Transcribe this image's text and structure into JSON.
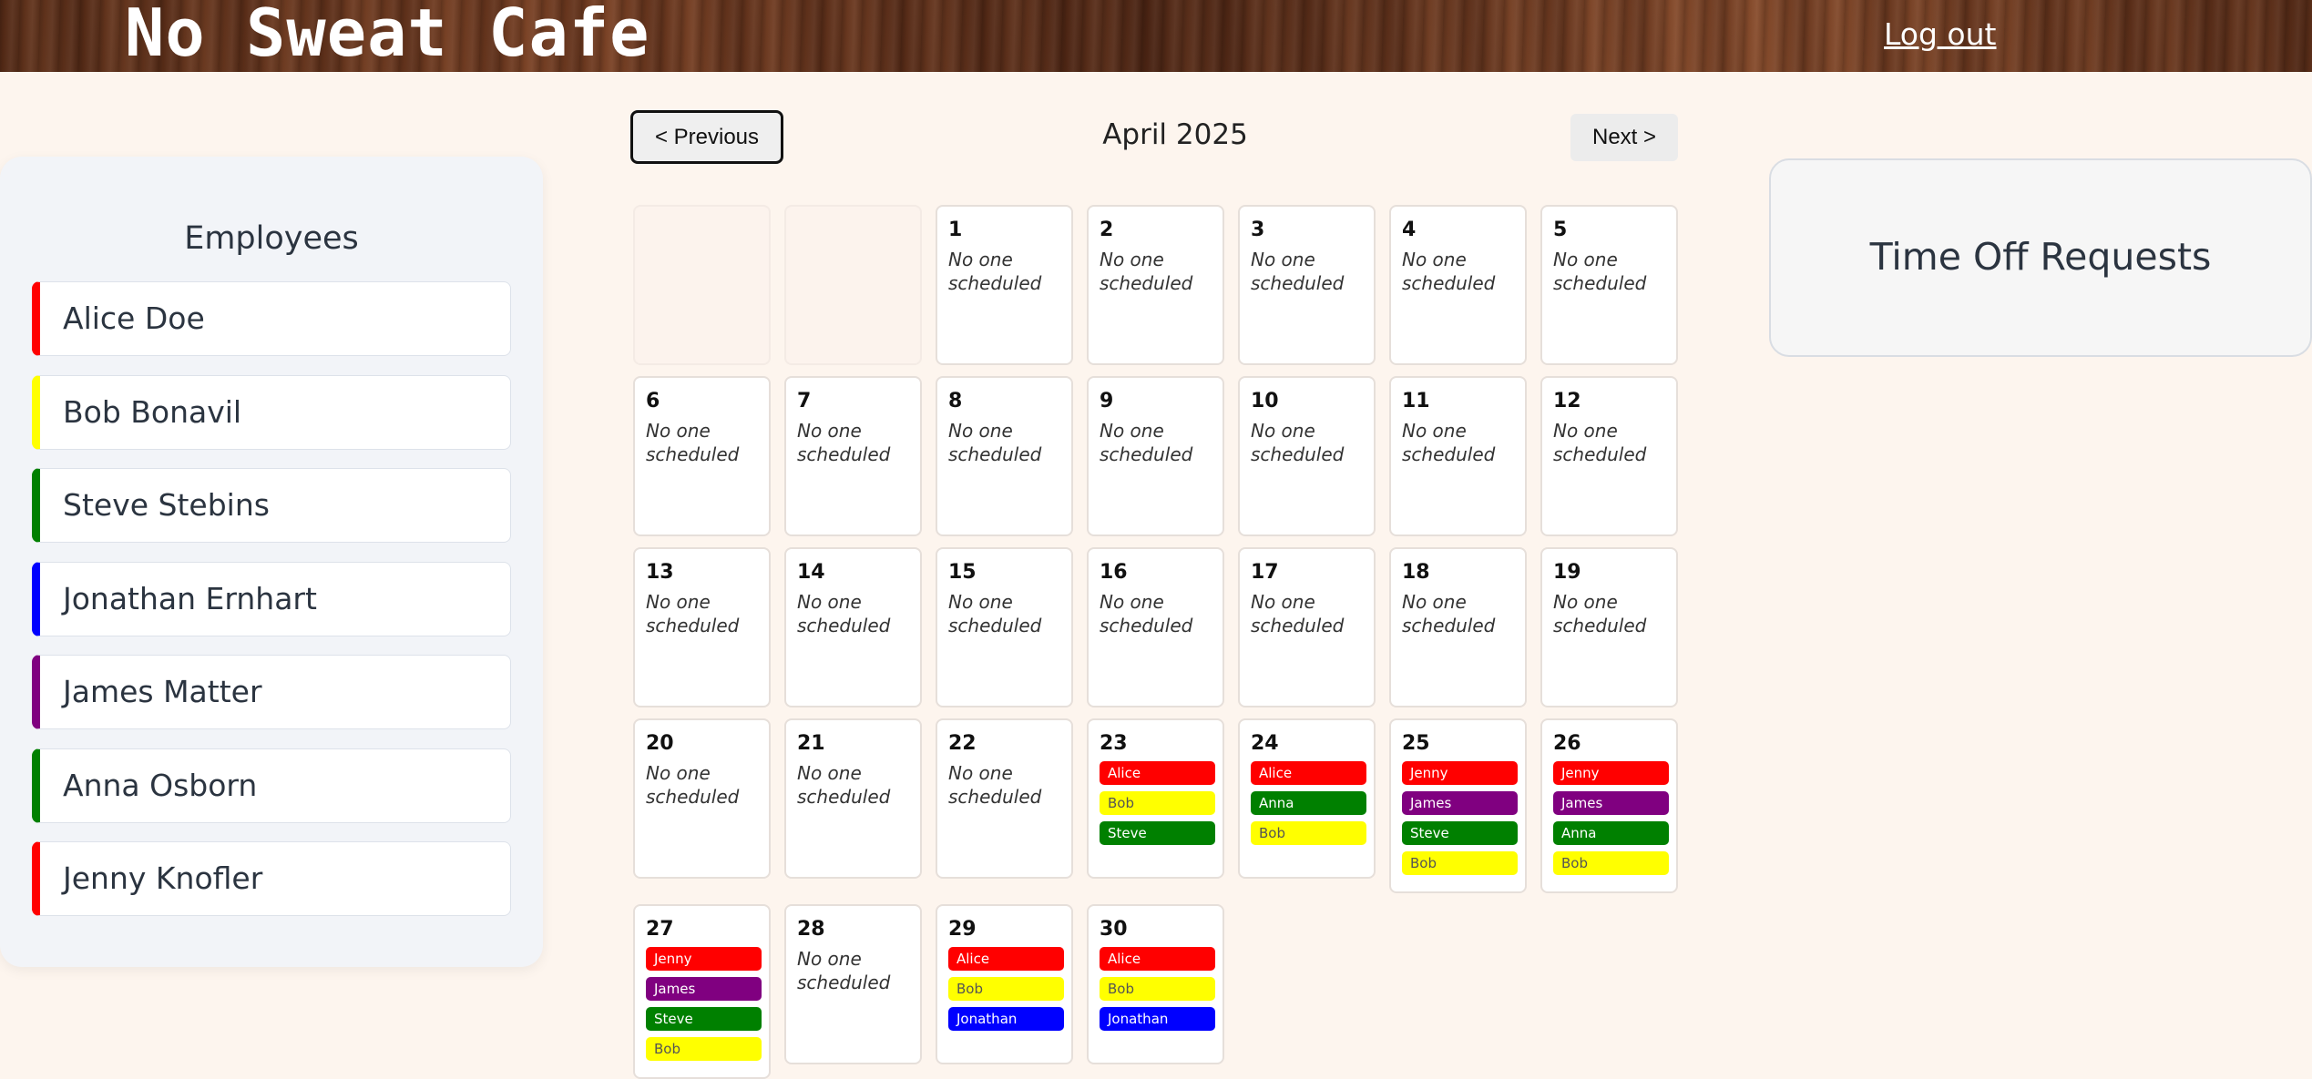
{
  "header": {
    "title": "No Sweat Cafe",
    "logout_label": "Log out"
  },
  "employees": {
    "title": "Employees",
    "items": [
      {
        "name": "Alice Doe",
        "color": "#ff0000"
      },
      {
        "name": "Bob Bonavil",
        "color": "#ffff00"
      },
      {
        "name": "Steve Stebins",
        "color": "#008000"
      },
      {
        "name": "Jonathan Ernhart",
        "color": "#0000ff"
      },
      {
        "name": "James Matter",
        "color": "#800080"
      },
      {
        "name": "Anna Osborn",
        "color": "#008000"
      },
      {
        "name": "Jenny Knofler",
        "color": "#ff0000"
      }
    ]
  },
  "calendar": {
    "month_title": "April 2025",
    "prev_label": "< Previous",
    "next_label": "Next >",
    "empty_text": "No one scheduled",
    "leading_blanks": 2,
    "days": [
      {
        "day": "1",
        "shifts": []
      },
      {
        "day": "2",
        "shifts": []
      },
      {
        "day": "3",
        "shifts": []
      },
      {
        "day": "4",
        "shifts": []
      },
      {
        "day": "5",
        "shifts": []
      },
      {
        "day": "6",
        "shifts": []
      },
      {
        "day": "7",
        "shifts": []
      },
      {
        "day": "8",
        "shifts": []
      },
      {
        "day": "9",
        "shifts": []
      },
      {
        "day": "10",
        "shifts": []
      },
      {
        "day": "11",
        "shifts": []
      },
      {
        "day": "12",
        "shifts": []
      },
      {
        "day": "13",
        "shifts": []
      },
      {
        "day": "14",
        "shifts": []
      },
      {
        "day": "15",
        "shifts": []
      },
      {
        "day": "16",
        "shifts": []
      },
      {
        "day": "17",
        "shifts": []
      },
      {
        "day": "18",
        "shifts": []
      },
      {
        "day": "19",
        "shifts": []
      },
      {
        "day": "20",
        "shifts": []
      },
      {
        "day": "21",
        "shifts": []
      },
      {
        "day": "22",
        "shifts": []
      },
      {
        "day": "23",
        "shifts": [
          {
            "name": "Alice",
            "bg": "#ff0000",
            "fg": "#ffffff"
          },
          {
            "name": "Bob",
            "bg": "#ffff00",
            "fg": "#555555"
          },
          {
            "name": "Steve",
            "bg": "#008000",
            "fg": "#ffffff"
          }
        ]
      },
      {
        "day": "24",
        "shifts": [
          {
            "name": "Alice",
            "bg": "#ff0000",
            "fg": "#ffffff"
          },
          {
            "name": "Anna",
            "bg": "#008000",
            "fg": "#ffffff"
          },
          {
            "name": "Bob",
            "bg": "#ffff00",
            "fg": "#555555"
          }
        ]
      },
      {
        "day": "25",
        "shifts": [
          {
            "name": "Jenny",
            "bg": "#ff0000",
            "fg": "#ffffff"
          },
          {
            "name": "James",
            "bg": "#800080",
            "fg": "#ffffff"
          },
          {
            "name": "Steve",
            "bg": "#008000",
            "fg": "#ffffff"
          },
          {
            "name": "Bob",
            "bg": "#ffff00",
            "fg": "#555555"
          }
        ]
      },
      {
        "day": "26",
        "shifts": [
          {
            "name": "Jenny",
            "bg": "#ff0000",
            "fg": "#ffffff"
          },
          {
            "name": "James",
            "bg": "#800080",
            "fg": "#ffffff"
          },
          {
            "name": "Anna",
            "bg": "#008000",
            "fg": "#ffffff"
          },
          {
            "name": "Bob",
            "bg": "#ffff00",
            "fg": "#555555"
          }
        ]
      },
      {
        "day": "27",
        "shifts": [
          {
            "name": "Jenny",
            "bg": "#ff0000",
            "fg": "#ffffff"
          },
          {
            "name": "James",
            "bg": "#800080",
            "fg": "#ffffff"
          },
          {
            "name": "Steve",
            "bg": "#008000",
            "fg": "#ffffff"
          },
          {
            "name": "Bob",
            "bg": "#ffff00",
            "fg": "#555555"
          }
        ]
      },
      {
        "day": "28",
        "shifts": []
      },
      {
        "day": "29",
        "shifts": [
          {
            "name": "Alice",
            "bg": "#ff0000",
            "fg": "#ffffff"
          },
          {
            "name": "Bob",
            "bg": "#ffff00",
            "fg": "#555555"
          },
          {
            "name": "Jonathan",
            "bg": "#0000ff",
            "fg": "#ffffff"
          }
        ]
      },
      {
        "day": "30",
        "shifts": [
          {
            "name": "Alice",
            "bg": "#ff0000",
            "fg": "#ffffff"
          },
          {
            "name": "Bob",
            "bg": "#ffff00",
            "fg": "#555555"
          },
          {
            "name": "Jonathan",
            "bg": "#0000ff",
            "fg": "#ffffff"
          }
        ]
      }
    ]
  },
  "time_off": {
    "title": "Time Off Requests"
  }
}
